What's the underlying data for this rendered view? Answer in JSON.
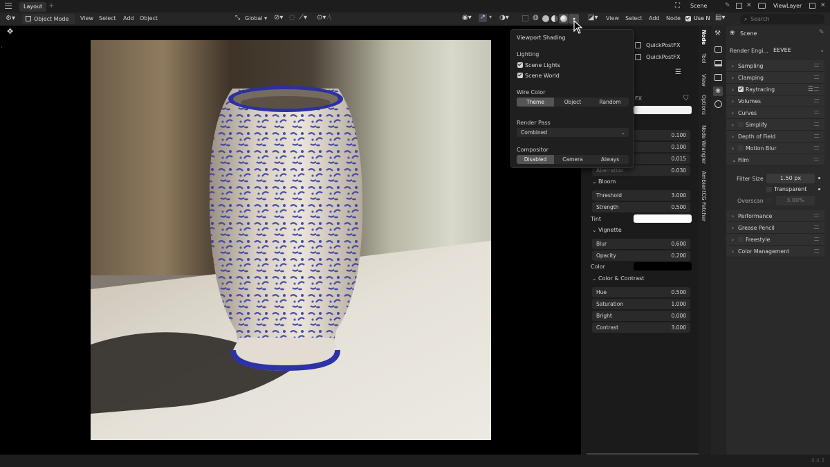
{
  "topbar": {
    "workspace_tab": "Layout",
    "add_tab": "+",
    "scene_name": "Scene",
    "view_layer_name": "ViewLayer"
  },
  "viewport_header": {
    "mode": "Object Mode",
    "menus": [
      "View",
      "Select",
      "Add",
      "Object"
    ],
    "transform_orientation": "Global"
  },
  "node_header": {
    "menus": [
      "View",
      "Select",
      "Add",
      "Node"
    ],
    "use_nodes_label": "Use N",
    "search_placeholder": "Search"
  },
  "viewport_shading_popup": {
    "title": "Viewport Shading",
    "lighting_label": "Lighting",
    "scene_lights": "Scene Lights",
    "scene_world": "Scene World",
    "wire_color_label": "Wire Color",
    "wire_color_options": [
      "Theme",
      "Object",
      "Random"
    ],
    "render_pass_label": "Render Pass",
    "render_pass_value": "Combined",
    "compositor_label": "Compositor",
    "compositor_options": [
      "Disabled",
      "Camera",
      "Always"
    ]
  },
  "node_panel": {
    "node_group_1": "QuickPostFX",
    "node_group_2": "QuickPostFX",
    "partial_label": "FX",
    "values_top": [
      {
        "label": "",
        "value": "0.100"
      },
      {
        "label": "",
        "value": "0.100"
      },
      {
        "label": "",
        "value": "0.015"
      },
      {
        "label": "Aberration",
        "value": "0.030"
      }
    ],
    "bloom": {
      "title": "Bloom",
      "threshold_label": "Threshold",
      "threshold": "3.000",
      "strength_label": "Strength",
      "strength": "0.500",
      "tint_label": "Tint",
      "tint_color": "#ffffff"
    },
    "vignette": {
      "title": "Vignette",
      "blur_label": "Blur",
      "blur": "0.600",
      "opacity_label": "Opacity",
      "opacity": "0.200",
      "color_label": "Color",
      "color": "#000000"
    },
    "color_contrast": {
      "title": "Color & Contrast",
      "hue_label": "Hue",
      "hue": "0.500",
      "saturation_label": "Saturation",
      "saturation": "1.000",
      "bright_label": "Bright",
      "bright": "0.000",
      "contrast_label": "Contrast",
      "contrast": "3.000"
    }
  },
  "sidebar_tabs": [
    "Node",
    "Tool",
    "View",
    "Options",
    "Node Wrangler",
    "AmbientCG Fetcher"
  ],
  "properties": {
    "context": "Scene",
    "render_engine_label": "Render Engi...",
    "render_engine_value": "EEVEE",
    "sections": [
      {
        "label": "Sampling"
      },
      {
        "label": "Clamping"
      },
      {
        "label": "Raytracing"
      },
      {
        "label": "Volumes"
      },
      {
        "label": "Curves"
      },
      {
        "label": "Simplify"
      },
      {
        "label": "Depth of Field"
      },
      {
        "label": "Motion Blur"
      },
      {
        "label": "Film"
      }
    ],
    "film": {
      "filter_size_label": "Filter Size",
      "filter_size": "1.50 px",
      "transparent_label": "Transparent",
      "overscan_label": "Overscan",
      "overscan": "3.00%"
    },
    "sections_after": [
      {
        "label": "Performance"
      },
      {
        "label": "Grease Pencil"
      },
      {
        "label": "Freestyle"
      },
      {
        "label": "Color Management"
      }
    ]
  },
  "status": {
    "version": "4.4.3"
  }
}
